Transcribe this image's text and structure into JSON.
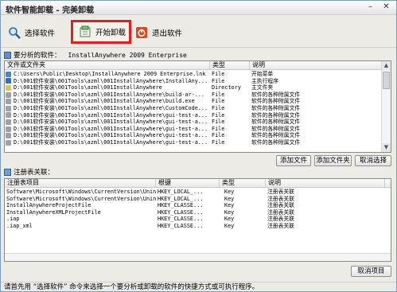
{
  "window": {
    "title": "软件智能卸载 - 完美卸载"
  },
  "toolbar": {
    "select_label": "选择软件",
    "start_label": "开始卸载",
    "exit_label": "退出软件"
  },
  "analyze": {
    "label": "要分析的软件：",
    "value": "InstallAnywhere 2009 Enterprise"
  },
  "files": {
    "columns": [
      "文件或文件夹",
      "类型",
      "说明"
    ],
    "rows": [
      {
        "icon": "shortcut",
        "path": "C:\\Users\\Public\\Desktop\\InstallAnywhere 2009 Enterprise.lnk",
        "type": "File",
        "desc": "开始菜单"
      },
      {
        "icon": "app",
        "path": "D:\\001软件安装\\001Tools\\azml\\001InstallAnywhere\\InstallAny...",
        "type": "File",
        "desc": "主执行程序"
      },
      {
        "icon": "folder",
        "path": "D:\\001软件安装\\001Tools\\azml\\001InstallAnywhere",
        "type": "Directory",
        "desc": "主文件夹"
      },
      {
        "icon": "file",
        "path": "D:\\001软件安装\\001Tools\\azml\\001InstallAnywhere\\build-ar-...",
        "type": "File",
        "desc": "软件的各种附属文件"
      },
      {
        "icon": "file",
        "path": "D:\\001软件安装\\001Tools\\azml\\001InstallAnywhere\\build.exe",
        "type": "File",
        "desc": "软件的各种附属文件"
      },
      {
        "icon": "file",
        "path": "D:\\001软件安装\\001Tools\\azml\\001InstallAnywhere\\CustomCode...",
        "type": "File",
        "desc": "软件的各种附属文件"
      },
      {
        "icon": "file",
        "path": "D:\\001软件安装\\001Tools\\azml\\001InstallAnywhere\\gui-test-a...",
        "type": "File",
        "desc": "软件的各种附属文件"
      },
      {
        "icon": "file",
        "path": "D:\\001软件安装\\001Tools\\azml\\001InstallAnywhere\\gui-test-a...",
        "type": "File",
        "desc": "软件的各种附属文件"
      },
      {
        "icon": "file",
        "path": "D:\\001软件安装\\001Tools\\azml\\001InstallAnywhere\\gui-test-a...",
        "type": "File",
        "desc": "软件的各种附属文件"
      },
      {
        "icon": "file",
        "path": "D:\\001软件安装\\001Tools\\azml\\001InstallAnywhere\\gui-test-a...",
        "type": "File",
        "desc": "软件的各种附属文件"
      },
      {
        "icon": "file",
        "path": "D:\\001软件安装\\001Tools\\azml\\001InstallAnywhere\\gui-test-a...",
        "type": "File",
        "desc": "软件的各种附属文件"
      }
    ],
    "buttons": {
      "add_file": "添加文件",
      "add_folder": "添加文件夹",
      "cancel_select": "取消选择"
    }
  },
  "registry": {
    "section_label": "注册表关联：",
    "columns": [
      "注册表项目",
      "根键",
      "类型",
      "说明"
    ],
    "rows": [
      {
        "item": "Software\\Microsoft\\Windows\\CurrentVersion\\Unin...",
        "root": "HKEY_LOCAL_...",
        "type": "Key",
        "desc": "注册表关联"
      },
      {
        "item": "Software\\Microsoft\\Windows\\CurrentVersion\\Unin...",
        "root": "HKEY_LOCAL_...",
        "type": "Key",
        "desc": "注册表关联"
      },
      {
        "item": "InstallAnywhereProjectFile",
        "root": "HKEY_CLASSE...",
        "type": "Key",
        "desc": "注册表关联"
      },
      {
        "item": "InstallAnywhereXMLProjectFile",
        "root": "HKEY_CLASSE...",
        "type": "Key",
        "desc": "注册表关联"
      },
      {
        "item": ".iap",
        "root": "HKEY_CLASSE...",
        "type": "Key",
        "desc": "注册表关联"
      },
      {
        "item": ".iap_xml",
        "root": "HKEY_CLASSE...",
        "type": "Key",
        "desc": "注册表关联"
      }
    ],
    "cancel_item": "取消项目"
  },
  "status": {
    "text": "请首先用 “选择软件” 命令来选择一个要分析或卸载的软件的快捷方式或可执行程序。"
  },
  "colors": {
    "highlight_box": "#e02020",
    "window_bg": "#ecebe6"
  }
}
